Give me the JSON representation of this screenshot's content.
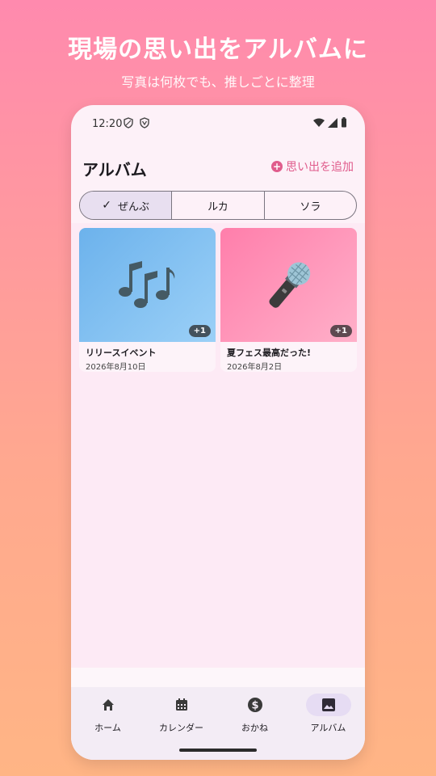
{
  "promo": {
    "title": "現場の思い出をアルバムに",
    "subtitle": "写真は何枚でも、推しごとに整理"
  },
  "status_bar": {
    "time": "12:20"
  },
  "header": {
    "title": "アルバム",
    "add_label": "思い出を追加"
  },
  "filters": [
    {
      "label": "ぜんぶ",
      "selected": true
    },
    {
      "label": "ルカ",
      "selected": false
    },
    {
      "label": "ソラ",
      "selected": false
    }
  ],
  "albums": [
    {
      "title": "リリースイベント",
      "date": "2026年8月10日",
      "extra": "+1",
      "emoji_name": "musical-notes"
    },
    {
      "title": "夏フェス最高だった!",
      "date": "2026年8月2日",
      "extra": "+1",
      "emoji_name": "microphone"
    }
  ],
  "nav": [
    {
      "label": "ホーム",
      "icon": "home-icon",
      "active": false
    },
    {
      "label": "カレンダー",
      "icon": "calendar-icon",
      "active": false
    },
    {
      "label": "おかね",
      "icon": "dollar-icon",
      "active": false
    },
    {
      "label": "アルバム",
      "icon": "image-icon",
      "active": true
    }
  ],
  "colors": {
    "accent": "#e05c8c",
    "selected_segment": "#e8dff0",
    "background": "#fdf1f8"
  }
}
